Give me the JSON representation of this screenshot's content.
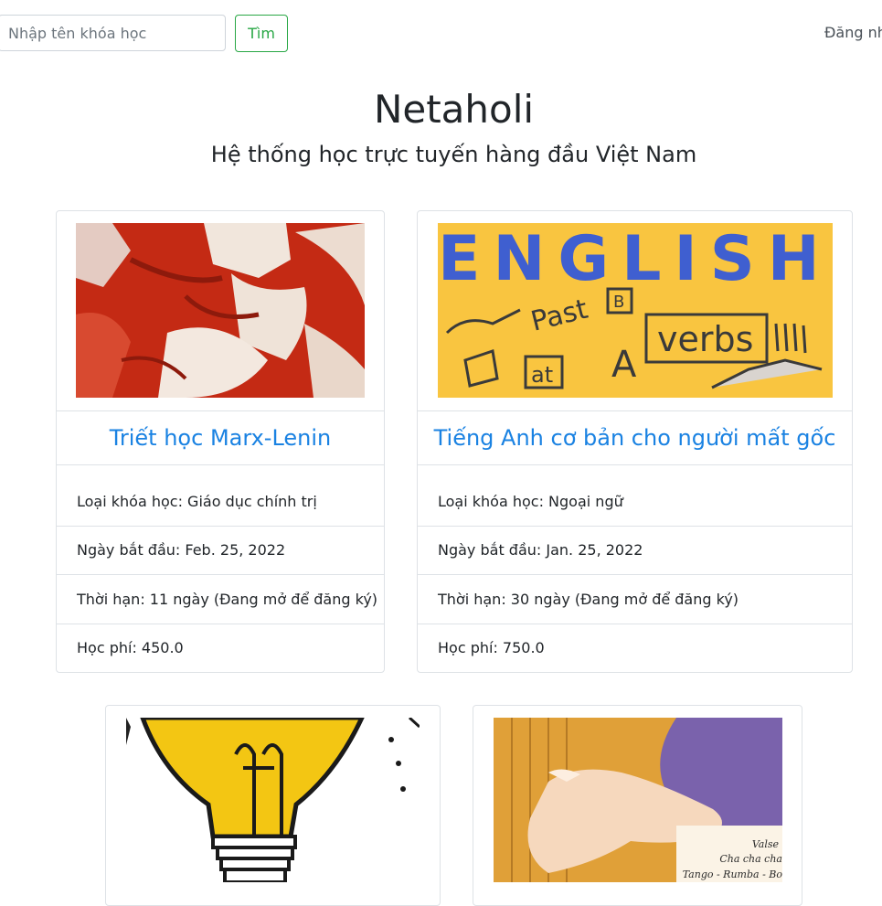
{
  "nav": {
    "search_placeholder": "Nhập tên khóa học",
    "search_button": "Tìm",
    "login_label": "Đăng nh"
  },
  "hero": {
    "title": "Netaholi",
    "subtitle": "Hệ thống học trực tuyến hàng đầu Việt Nam"
  },
  "courses": [
    {
      "title": "Triết học Marx-Lenin",
      "category": "Loại khóa học: Giáo dục chính trị",
      "start_date": "Ngày bắt đầu: Feb. 25, 2022",
      "duration": "Thời hạn: 11 ngày (Đang mở để đăng ký)",
      "fee": "Học phí: 450.0"
    },
    {
      "title": "Tiếng Anh cơ bản cho người mất gốc",
      "category": "Loại khóa học: Ngoại ngữ",
      "start_date": "Ngày bắt đầu: Jan. 25, 2022",
      "duration": "Thời hạn: 30 ngày (Đang mở để đăng ký)",
      "fee": "Học phí: 750.0",
      "image_text": {
        "headline": "ENGLISH",
        "words": [
          "Past",
          "verbs",
          "at",
          "A",
          "B"
        ]
      }
    },
    {
      "image_subject": "lightbulb"
    },
    {
      "image_subject": "guitar",
      "image_text": [
        "Valse",
        "Cha cha cha",
        "Tango - Rumba - Bo"
      ]
    }
  ],
  "colors": {
    "link": "#1a82e2",
    "success": "#28a745",
    "border": "#dee2e6",
    "english_bg": "#f9c540",
    "english_blue": "#3f5fd0",
    "marx_red": "#c42a14",
    "guitar_purple": "#7a62ac",
    "guitar_orange": "#e0a038"
  }
}
